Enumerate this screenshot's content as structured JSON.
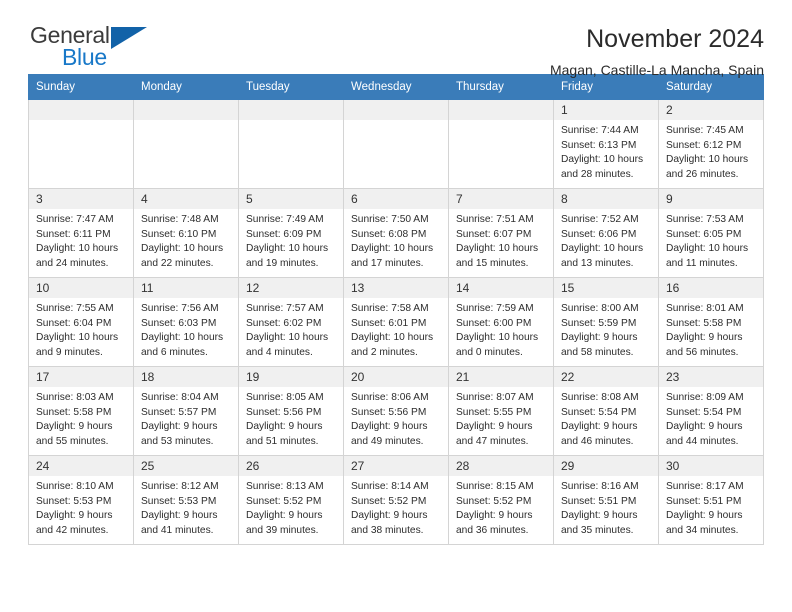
{
  "brand": {
    "name_top": "General",
    "name_bottom": "Blue",
    "triangle_icon": "brand-triangle-icon",
    "color_top": "#3b3b3b",
    "color_bottom": "#1878c8",
    "triangle_color": "#1262a8"
  },
  "header": {
    "title": "November 2024",
    "subtitle": "Magan, Castille-La Mancha, Spain"
  },
  "theme": {
    "header_blue": "#3a7cb9",
    "daynum_band": "#f0f0f0",
    "grid_border": "#d4d4d4"
  },
  "weekdays": [
    "Sunday",
    "Monday",
    "Tuesday",
    "Wednesday",
    "Thursday",
    "Friday",
    "Saturday"
  ],
  "weeks": [
    [
      {
        "day": "",
        "empty": true
      },
      {
        "day": "",
        "empty": true
      },
      {
        "day": "",
        "empty": true
      },
      {
        "day": "",
        "empty": true
      },
      {
        "day": "",
        "empty": true
      },
      {
        "day": "1",
        "sunrise": "Sunrise: 7:44 AM",
        "sunset": "Sunset: 6:13 PM",
        "daylight": "Daylight: 10 hours and 28 minutes."
      },
      {
        "day": "2",
        "sunrise": "Sunrise: 7:45 AM",
        "sunset": "Sunset: 6:12 PM",
        "daylight": "Daylight: 10 hours and 26 minutes."
      }
    ],
    [
      {
        "day": "3",
        "sunrise": "Sunrise: 7:47 AM",
        "sunset": "Sunset: 6:11 PM",
        "daylight": "Daylight: 10 hours and 24 minutes."
      },
      {
        "day": "4",
        "sunrise": "Sunrise: 7:48 AM",
        "sunset": "Sunset: 6:10 PM",
        "daylight": "Daylight: 10 hours and 22 minutes."
      },
      {
        "day": "5",
        "sunrise": "Sunrise: 7:49 AM",
        "sunset": "Sunset: 6:09 PM",
        "daylight": "Daylight: 10 hours and 19 minutes."
      },
      {
        "day": "6",
        "sunrise": "Sunrise: 7:50 AM",
        "sunset": "Sunset: 6:08 PM",
        "daylight": "Daylight: 10 hours and 17 minutes."
      },
      {
        "day": "7",
        "sunrise": "Sunrise: 7:51 AM",
        "sunset": "Sunset: 6:07 PM",
        "daylight": "Daylight: 10 hours and 15 minutes."
      },
      {
        "day": "8",
        "sunrise": "Sunrise: 7:52 AM",
        "sunset": "Sunset: 6:06 PM",
        "daylight": "Daylight: 10 hours and 13 minutes."
      },
      {
        "day": "9",
        "sunrise": "Sunrise: 7:53 AM",
        "sunset": "Sunset: 6:05 PM",
        "daylight": "Daylight: 10 hours and 11 minutes."
      }
    ],
    [
      {
        "day": "10",
        "sunrise": "Sunrise: 7:55 AM",
        "sunset": "Sunset: 6:04 PM",
        "daylight": "Daylight: 10 hours and 9 minutes."
      },
      {
        "day": "11",
        "sunrise": "Sunrise: 7:56 AM",
        "sunset": "Sunset: 6:03 PM",
        "daylight": "Daylight: 10 hours and 6 minutes."
      },
      {
        "day": "12",
        "sunrise": "Sunrise: 7:57 AM",
        "sunset": "Sunset: 6:02 PM",
        "daylight": "Daylight: 10 hours and 4 minutes."
      },
      {
        "day": "13",
        "sunrise": "Sunrise: 7:58 AM",
        "sunset": "Sunset: 6:01 PM",
        "daylight": "Daylight: 10 hours and 2 minutes."
      },
      {
        "day": "14",
        "sunrise": "Sunrise: 7:59 AM",
        "sunset": "Sunset: 6:00 PM",
        "daylight": "Daylight: 10 hours and 0 minutes."
      },
      {
        "day": "15",
        "sunrise": "Sunrise: 8:00 AM",
        "sunset": "Sunset: 5:59 PM",
        "daylight": "Daylight: 9 hours and 58 minutes."
      },
      {
        "day": "16",
        "sunrise": "Sunrise: 8:01 AM",
        "sunset": "Sunset: 5:58 PM",
        "daylight": "Daylight: 9 hours and 56 minutes."
      }
    ],
    [
      {
        "day": "17",
        "sunrise": "Sunrise: 8:03 AM",
        "sunset": "Sunset: 5:58 PM",
        "daylight": "Daylight: 9 hours and 55 minutes."
      },
      {
        "day": "18",
        "sunrise": "Sunrise: 8:04 AM",
        "sunset": "Sunset: 5:57 PM",
        "daylight": "Daylight: 9 hours and 53 minutes."
      },
      {
        "day": "19",
        "sunrise": "Sunrise: 8:05 AM",
        "sunset": "Sunset: 5:56 PM",
        "daylight": "Daylight: 9 hours and 51 minutes."
      },
      {
        "day": "20",
        "sunrise": "Sunrise: 8:06 AM",
        "sunset": "Sunset: 5:56 PM",
        "daylight": "Daylight: 9 hours and 49 minutes."
      },
      {
        "day": "21",
        "sunrise": "Sunrise: 8:07 AM",
        "sunset": "Sunset: 5:55 PM",
        "daylight": "Daylight: 9 hours and 47 minutes."
      },
      {
        "day": "22",
        "sunrise": "Sunrise: 8:08 AM",
        "sunset": "Sunset: 5:54 PM",
        "daylight": "Daylight: 9 hours and 46 minutes."
      },
      {
        "day": "23",
        "sunrise": "Sunrise: 8:09 AM",
        "sunset": "Sunset: 5:54 PM",
        "daylight": "Daylight: 9 hours and 44 minutes."
      }
    ],
    [
      {
        "day": "24",
        "sunrise": "Sunrise: 8:10 AM",
        "sunset": "Sunset: 5:53 PM",
        "daylight": "Daylight: 9 hours and 42 minutes."
      },
      {
        "day": "25",
        "sunrise": "Sunrise: 8:12 AM",
        "sunset": "Sunset: 5:53 PM",
        "daylight": "Daylight: 9 hours and 41 minutes."
      },
      {
        "day": "26",
        "sunrise": "Sunrise: 8:13 AM",
        "sunset": "Sunset: 5:52 PM",
        "daylight": "Daylight: 9 hours and 39 minutes."
      },
      {
        "day": "27",
        "sunrise": "Sunrise: 8:14 AM",
        "sunset": "Sunset: 5:52 PM",
        "daylight": "Daylight: 9 hours and 38 minutes."
      },
      {
        "day": "28",
        "sunrise": "Sunrise: 8:15 AM",
        "sunset": "Sunset: 5:52 PM",
        "daylight": "Daylight: 9 hours and 36 minutes."
      },
      {
        "day": "29",
        "sunrise": "Sunrise: 8:16 AM",
        "sunset": "Sunset: 5:51 PM",
        "daylight": "Daylight: 9 hours and 35 minutes."
      },
      {
        "day": "30",
        "sunrise": "Sunrise: 8:17 AM",
        "sunset": "Sunset: 5:51 PM",
        "daylight": "Daylight: 9 hours and 34 minutes."
      }
    ]
  ]
}
